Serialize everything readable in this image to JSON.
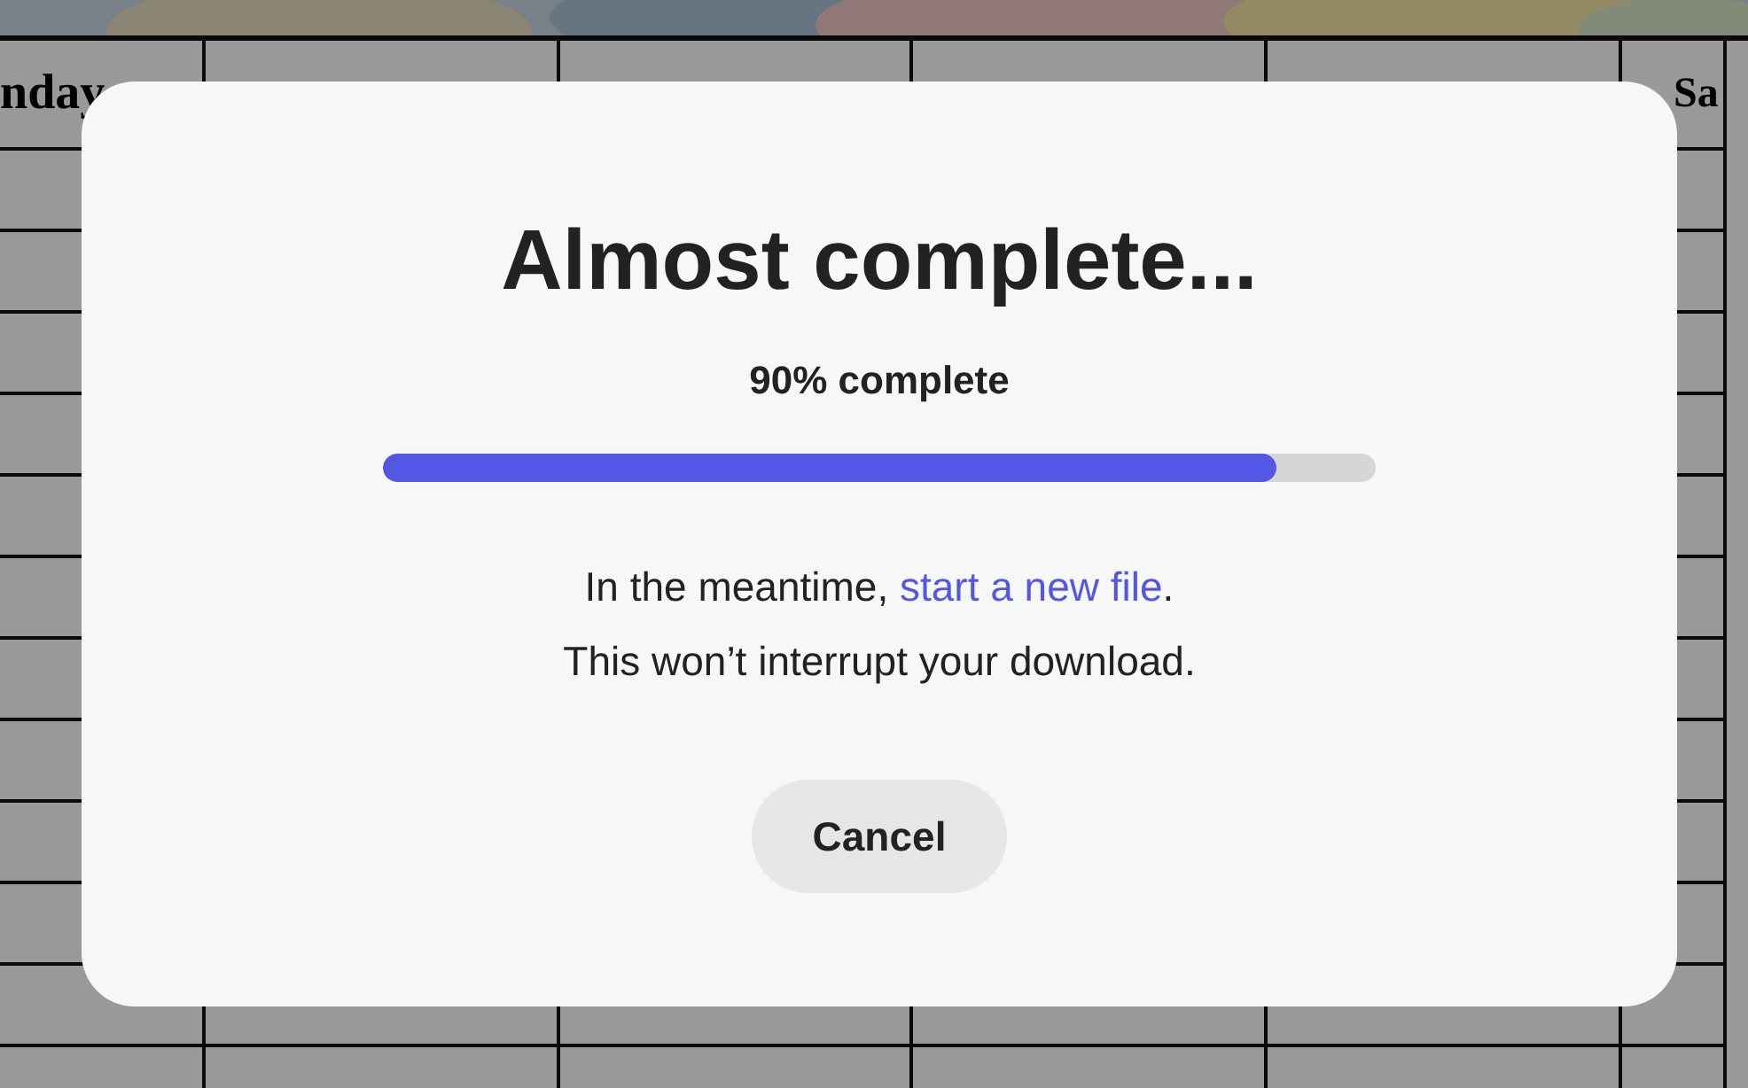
{
  "background": {
    "calendar": {
      "columns": [
        {
          "heading": "nday"
        },
        {},
        {},
        {},
        {},
        {
          "heading": "Sa"
        }
      ]
    }
  },
  "dialog": {
    "title": "Almost complete...",
    "progress": {
      "label": "90% complete",
      "level": 0.9
    },
    "message": {
      "before": "In the meantime, ",
      "link": "start a new file",
      "after": "."
    },
    "note": "This won’t interrupt your download.",
    "buttons": [
      {
        "label": "Cancel"
      }
    ]
  }
}
